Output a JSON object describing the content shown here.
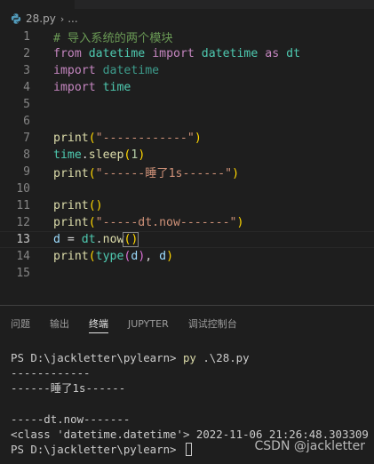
{
  "breadcrumb": {
    "filename": "28.py",
    "ellipsis": "..."
  },
  "editor": {
    "lines": [
      {
        "n": "1",
        "c": [
          "# 导入系统的两个模块"
        ]
      },
      {
        "n": "2",
        "c": [
          "from",
          " ",
          "datetime",
          " ",
          "import",
          " ",
          "datetime",
          " ",
          "as",
          " ",
          "dt"
        ]
      },
      {
        "n": "3",
        "c": [
          "import",
          " ",
          "datetime"
        ]
      },
      {
        "n": "4",
        "c": [
          "import",
          " ",
          "time"
        ]
      },
      {
        "n": "5",
        "c": []
      },
      {
        "n": "6",
        "c": []
      },
      {
        "n": "7",
        "c": [
          "print",
          "(",
          "\"------------\"",
          ")"
        ]
      },
      {
        "n": "8",
        "c": [
          "time",
          ".",
          "sleep",
          "(",
          "1",
          ")"
        ]
      },
      {
        "n": "9",
        "c": [
          "print",
          "(",
          "\"------睡了1s------\"",
          ")"
        ]
      },
      {
        "n": "10",
        "c": []
      },
      {
        "n": "11",
        "c": [
          "print",
          "()"
        ]
      },
      {
        "n": "12",
        "c": [
          "print",
          "(",
          "\"-----dt.now-------\"",
          ")"
        ]
      },
      {
        "n": "13",
        "c": [
          "d",
          " = ",
          "dt",
          ".",
          "now",
          "()"
        ]
      },
      {
        "n": "14",
        "c": [
          "print",
          "(",
          "type",
          "(",
          "d",
          ")",
          ", ",
          "d",
          ")"
        ]
      },
      {
        "n": "15",
        "c": []
      }
    ]
  },
  "panel": {
    "tabs": [
      "问题",
      "输出",
      "终端",
      "JUPYTER",
      "调试控制台"
    ],
    "active_tab": "终端"
  },
  "terminal": {
    "lines": [
      {
        "prompt": "PS D:\\jackletter\\pylearn> ",
        "cmd": "py",
        "args": " .\\28.py"
      },
      {
        "text": "------------"
      },
      {
        "text": "------睡了1s------"
      },
      {
        "text": ""
      },
      {
        "text": "-----dt.now-------"
      },
      {
        "text": "<class 'datetime.datetime'> 2022-11-06 21:26:48.303309"
      },
      {
        "prompt": "PS D:\\jackletter\\pylearn> ",
        "cursor": true
      }
    ]
  },
  "watermark": "CSDN @jackletter"
}
